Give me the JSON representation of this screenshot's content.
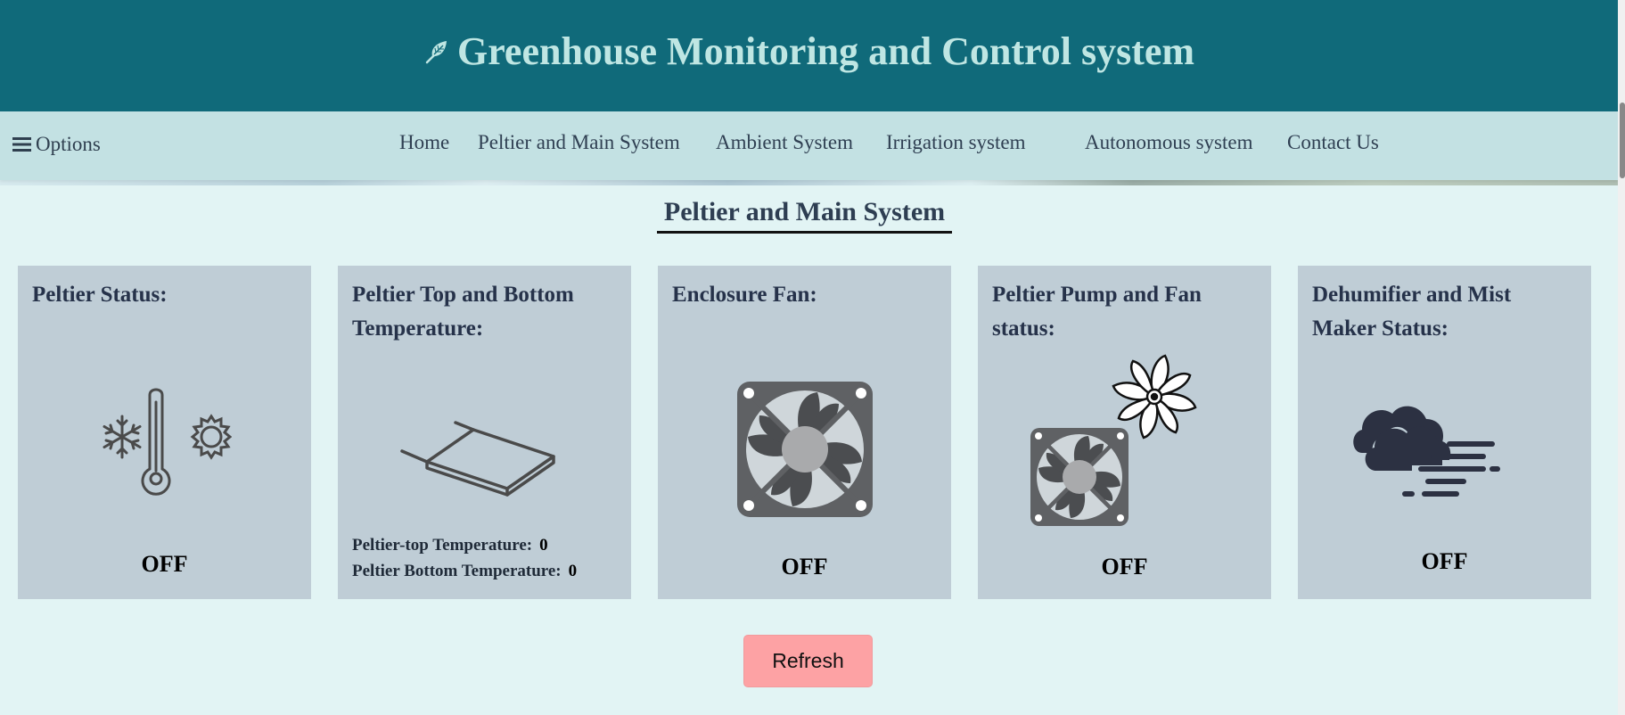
{
  "header": {
    "title": "Greenhouse Monitoring and Control system",
    "icon": "leaf-icon"
  },
  "nav": {
    "options_label": "Options",
    "items": [
      {
        "label": "Home"
      },
      {
        "label": "Peltier and Main System"
      },
      {
        "label": "Ambient System"
      },
      {
        "label": "Irrigation system"
      },
      {
        "label": "Autonomous system"
      },
      {
        "label": "Contact Us"
      }
    ]
  },
  "section": {
    "title": "Peltier and Main System"
  },
  "cards": [
    {
      "title": "Peltier Status:",
      "status": "OFF",
      "icon": "thermometer-hot-cold-icon"
    },
    {
      "title": "Peltier Top and Bottom Temperature:",
      "icon": "peltier-module-icon",
      "top_label": "Peltier-top Temperature:",
      "top_value": "0",
      "bottom_label": "Peltier Bottom Temperature:",
      "bottom_value": "0"
    },
    {
      "title": "Enclosure Fan:",
      "status": "OFF",
      "icon": "fan-icon"
    },
    {
      "title": "Peltier Pump and Fan status:",
      "status": "OFF",
      "icon": "pump-fan-icon"
    },
    {
      "title": "Dehumifier and Mist Maker Status:",
      "status": "OFF",
      "icon": "cloud-wind-icon"
    }
  ],
  "refresh_label": "Refresh",
  "colors": {
    "header_bg": "#106a7a",
    "header_text": "#bfe6e3",
    "nav_bg": "#c3e1e3",
    "page_bg": "#e2f4f4",
    "card_bg": "#bfcdd6",
    "refresh_bg": "#fda2a4"
  }
}
